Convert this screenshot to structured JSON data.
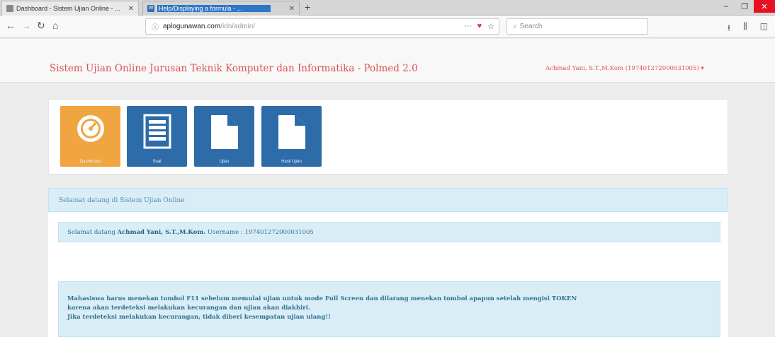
{
  "browser": {
    "tabs": [
      {
        "title": "Dashboard - Sistem Ujian Online - ...",
        "active": false
      },
      {
        "title": "Help/Displaying a formula - ...",
        "active": true
      }
    ],
    "new_tab": "+",
    "url_domain": "aplogunawan.com",
    "url_path": "/idn/admin/",
    "url_more": "···",
    "search_placeholder": "Search",
    "window_controls": {
      "minimize": "–",
      "maximize": "❐",
      "close": "✕"
    }
  },
  "header": {
    "brand": "Sistem Ujian Online Jurusan Teknik Komputer dan Informatika - Polmed 2.0",
    "user": "Achmad Yani, S.T.,M.Kom (197401272000031005) ▾"
  },
  "tiles": [
    {
      "label": "Dashboard",
      "icon": "dashboard-icon",
      "color": "#f0a541"
    },
    {
      "label": "Soal",
      "icon": "list-icon",
      "color": "#2e6ca9"
    },
    {
      "label": "Ujian",
      "icon": "file-icon",
      "color": "#2e6ca9"
    },
    {
      "label": "Hasil Ujian",
      "icon": "file-icon",
      "color": "#2e6ca9"
    }
  ],
  "welcome": {
    "heading": "Selamat datang di Sistem Ujian Online",
    "greeting_prefix": "Selamat datang ",
    "user_name": "Achmad Yani, S.T.,M.Kom.",
    "username_label": " Username : ",
    "username_value": "197401272000031005",
    "notice_lines": [
      "Mahasiswa harus menekan tombol F11 sebelum memulai ujian untuk mode Full Screen dan dilarang menekan tombol apapun setelah mengisi TOKEN",
      "karena akan terdeteksi melakukan kecurangan dan ujian akan diakhiri.",
      "Jika terdeteksi melakukan kecurangan, tidak diberi kesempatan ujian ulang!!"
    ]
  }
}
